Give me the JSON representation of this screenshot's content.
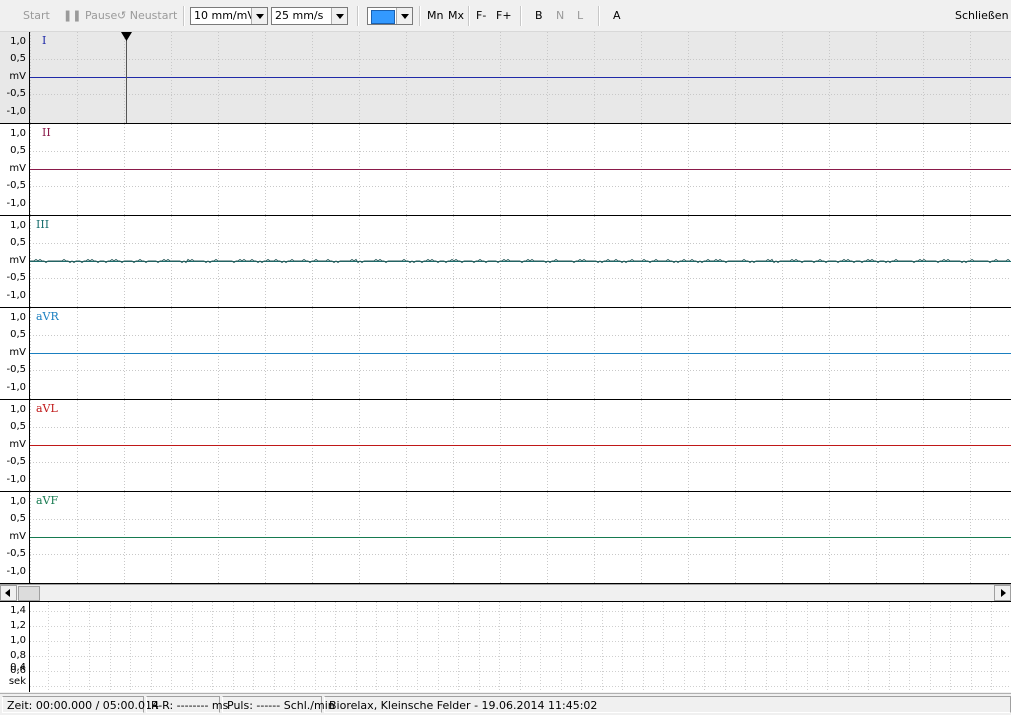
{
  "toolbar": {
    "start": "Start",
    "pause": "Pause",
    "restart": "Neustart",
    "gain": "10 mm/mV",
    "speed": "25 mm/s",
    "color_value": "#3399ff",
    "mn": "Mn",
    "mx": "Mx",
    "f_minus": "F-",
    "f_plus": "F+",
    "b": "B",
    "n": "N",
    "l": "L",
    "a": "A",
    "close": "Schließen"
  },
  "ecg_axis": [
    "1,0",
    "0,5",
    "mV",
    "-0,5",
    "-1,0"
  ],
  "leads": [
    {
      "name": "I",
      "color": "#1f2aa8"
    },
    {
      "name": "II",
      "color": "#8a1a4a"
    },
    {
      "name": "III",
      "color": "#1a6e6e"
    },
    {
      "name": "aVR",
      "color": "#1a7fc0"
    },
    {
      "name": "aVL",
      "color": "#c01818"
    },
    {
      "name": "aVF",
      "color": "#167a50"
    }
  ],
  "rr_axis": [
    "1,4",
    "1,2",
    "1,0",
    "0,8",
    "0,6",
    "0,4",
    "sek"
  ],
  "status": {
    "time": "Zeit: 00:00.000 / 05:00.014",
    "rr": "R-R: -------- ms",
    "pulse": "Puls: ------ Schl./min",
    "info": "Biorelax, Kleinsche Felder - 19.06.2014 11:45:02"
  }
}
